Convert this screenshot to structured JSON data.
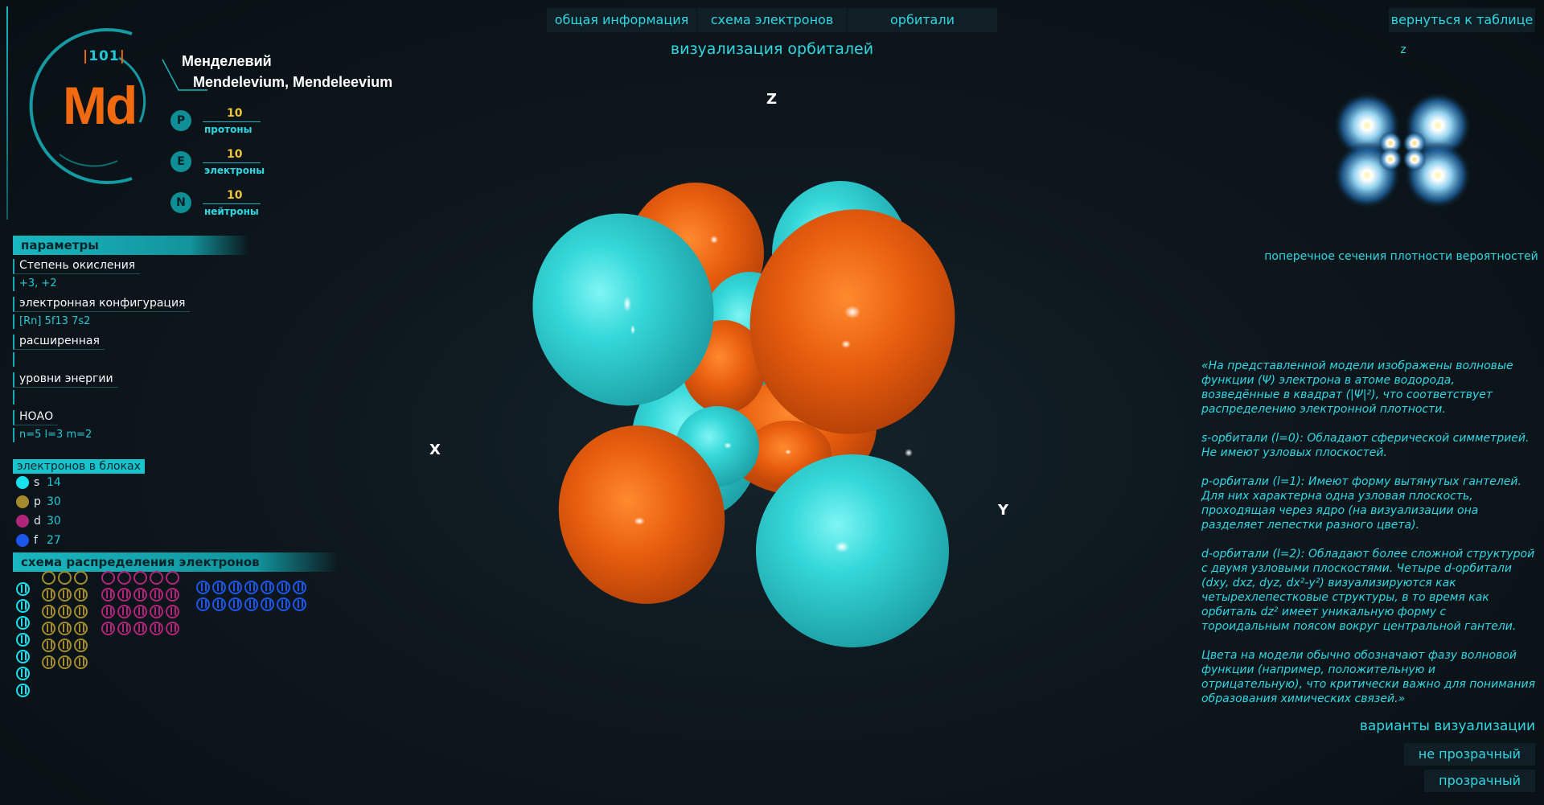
{
  "element": {
    "atomic_number": "101",
    "symbol": "Md",
    "name_ru": "Менделевий",
    "name_en": "Mendelevium, Mendeleevium"
  },
  "particles": [
    {
      "badge": "P",
      "count": "10",
      "label": "протоны"
    },
    {
      "badge": "E",
      "count": "10",
      "label": "электроны"
    },
    {
      "badge": "N",
      "count": "10",
      "label": "нейтроны"
    }
  ],
  "parameters": {
    "header": "параметры",
    "oxidation_label": "Степень окисления",
    "oxidation_value": "+3, +2",
    "config_label": "электронная конфигурация",
    "config_value": "[Rn] 5f13 7s2",
    "extended_label": "расширенная",
    "energy_label": "уровни энергии",
    "hoao_label": "НОАО",
    "hoao_value": "n=5  l=3  m=2"
  },
  "blocks": {
    "header": "электронов в блоках",
    "items": [
      {
        "letter": "s",
        "value": "14",
        "color": "#19e0ee"
      },
      {
        "letter": "p",
        "value": "30",
        "color": "#a38b2d"
      },
      {
        "letter": "d",
        "value": "30",
        "color": "#b0257a"
      },
      {
        "letter": "f",
        "value": "27",
        "color": "#1c56ea"
      }
    ]
  },
  "scheme": {
    "header": "схема распределения электронов"
  },
  "tabs": [
    {
      "label": "общая информация"
    },
    {
      "label": "схема электронов"
    },
    {
      "label": "орбитали"
    }
  ],
  "viz_title": "визуализация орбиталей",
  "axes": {
    "z": "Z",
    "x": "X",
    "y": "Y",
    "mini_z": "z"
  },
  "colors": {
    "phase_positive": "#2fd6d8",
    "phase_negative": "#e8580e",
    "accent": "#2fd7e2"
  },
  "right": {
    "back_button": "вернуться к таблице",
    "minimap_caption": "поперечное сечения плотности вероятностей",
    "description": [
      "«На представленной модели изображены волновые функции (Ψ) электрона в атоме водорода, возведённые в квадрат (|Ψ|²), что соответствует распределению электронной плотности.",
      "s-орбитали (l=0): Обладают сферической симметрией. Не имеют узловых плоскостей.",
      "p-орбитали (l=1): Имеют форму вытянутых гантелей. Для них характерна одна узловая плоскость, проходящая через ядро (на визуализации она разделяет лепестки разного цвета).",
      "d-орбитали (l=2): Обладают более сложной структурой с двумя узловыми плоскостями. Четыре d-орбитали (dxy, dxz, dyz, dx²-y²) визуализируются как четырехлепестковые структуры, в то время как орбиталь dz² имеет уникальную форму с тороидальным поясом вокруг центральной гантели.",
      "Цвета на модели обычно обозначают фазу волновой функции (например, положительную и отрицательную), что критически важно для понимания образования химических связей.»"
    ],
    "variants_title": "варианты визуализации",
    "variant_opaque": "не прозрачный",
    "variant_transparent": "прозрачный"
  }
}
